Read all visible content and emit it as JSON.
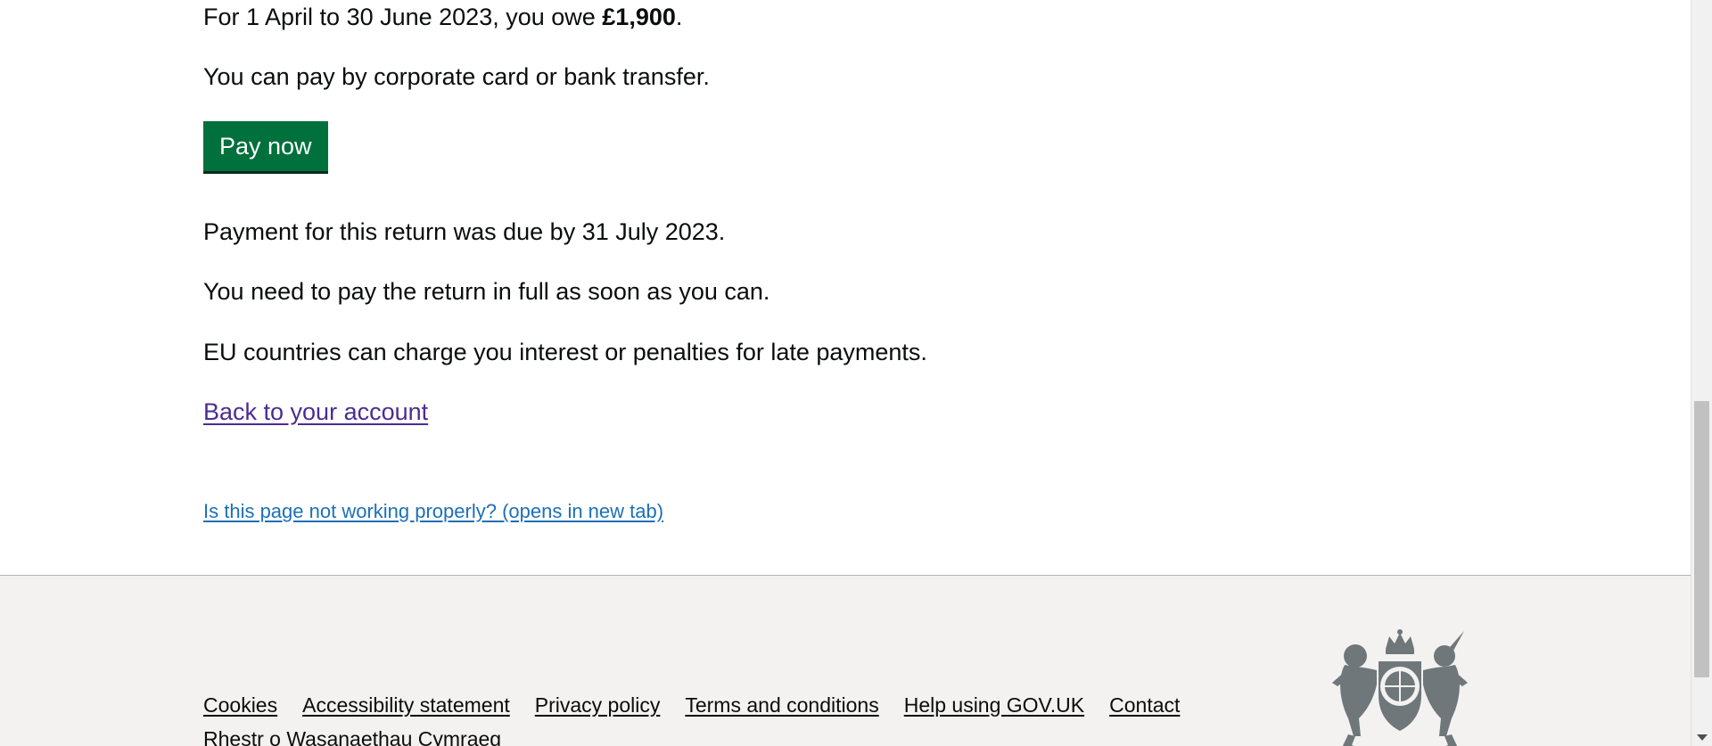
{
  "content": {
    "owe_prefix": "For 1 April to 30 June 2023, you owe ",
    "owe_amount": "£1,900",
    "owe_suffix": ".",
    "pay_methods": "You can pay by corporate card or bank transfer.",
    "pay_button": "Pay now",
    "due_date": "Payment for this return was due by 31 July 2023.",
    "pay_in_full": "You need to pay the return in full as soon as you can.",
    "late_penalties": "EU countries can charge you interest or penalties for late payments.",
    "back_link": "Back to your account",
    "report_link": "Is this page not working properly? (opens in new tab)"
  },
  "footer": {
    "links": [
      "Cookies",
      "Accessibility statement",
      "Privacy policy",
      "Terms and conditions",
      "Help using GOV.UK",
      "Contact"
    ],
    "welsh_link": "Rhestr o Wasanaethau Cymraeg",
    "crest_icon": "royal-coat-of-arms-icon"
  },
  "colors": {
    "button_green": "#00703c",
    "visited_link": "#4c2c92",
    "link_blue": "#1d70b8",
    "footer_bg": "#f3f2f1"
  }
}
